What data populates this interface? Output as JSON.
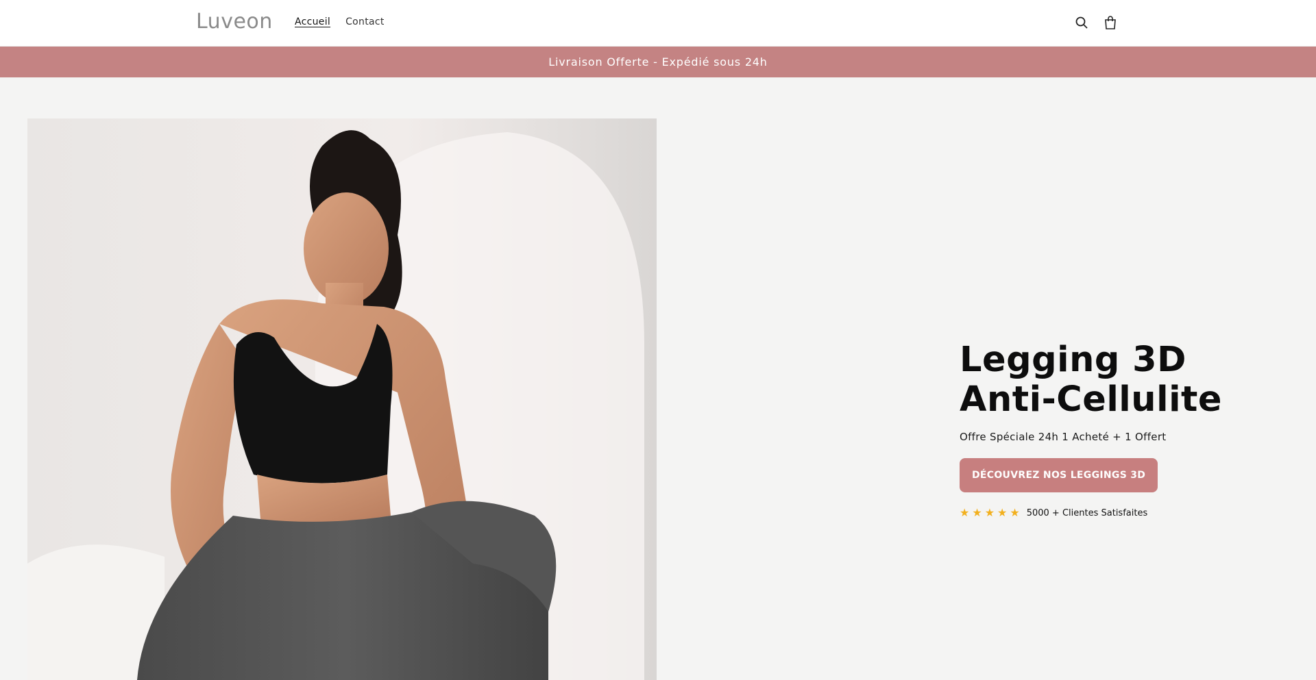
{
  "header": {
    "logo": "Luveon",
    "nav": [
      {
        "label": "Accueil"
      },
      {
        "label": "Contact"
      }
    ],
    "icons": [
      "search-icon",
      "cart-icon"
    ]
  },
  "announcement": {
    "text": "Livraison Offerte - Expédié sous 24h"
  },
  "hero": {
    "title_line1": "Legging 3D",
    "title_line2": "Anti-Cellulite",
    "subtitle": "Offre Spéciale 24h 1 Acheté + 1 Offert",
    "cta_label": "DÉCOUVREZ NOS LEGGINGS 3D",
    "rating": {
      "stars": 5,
      "text": "5000 + Clientes Satisfaites"
    },
    "image_alt": "woman-in-black-sports-bra-and-grey-leggings"
  },
  "colors": {
    "announcement_bg": "#c48383",
    "cta_bg": "#c77f7f",
    "star": "#f2b01e",
    "page_bg": "#f4f4f3"
  }
}
